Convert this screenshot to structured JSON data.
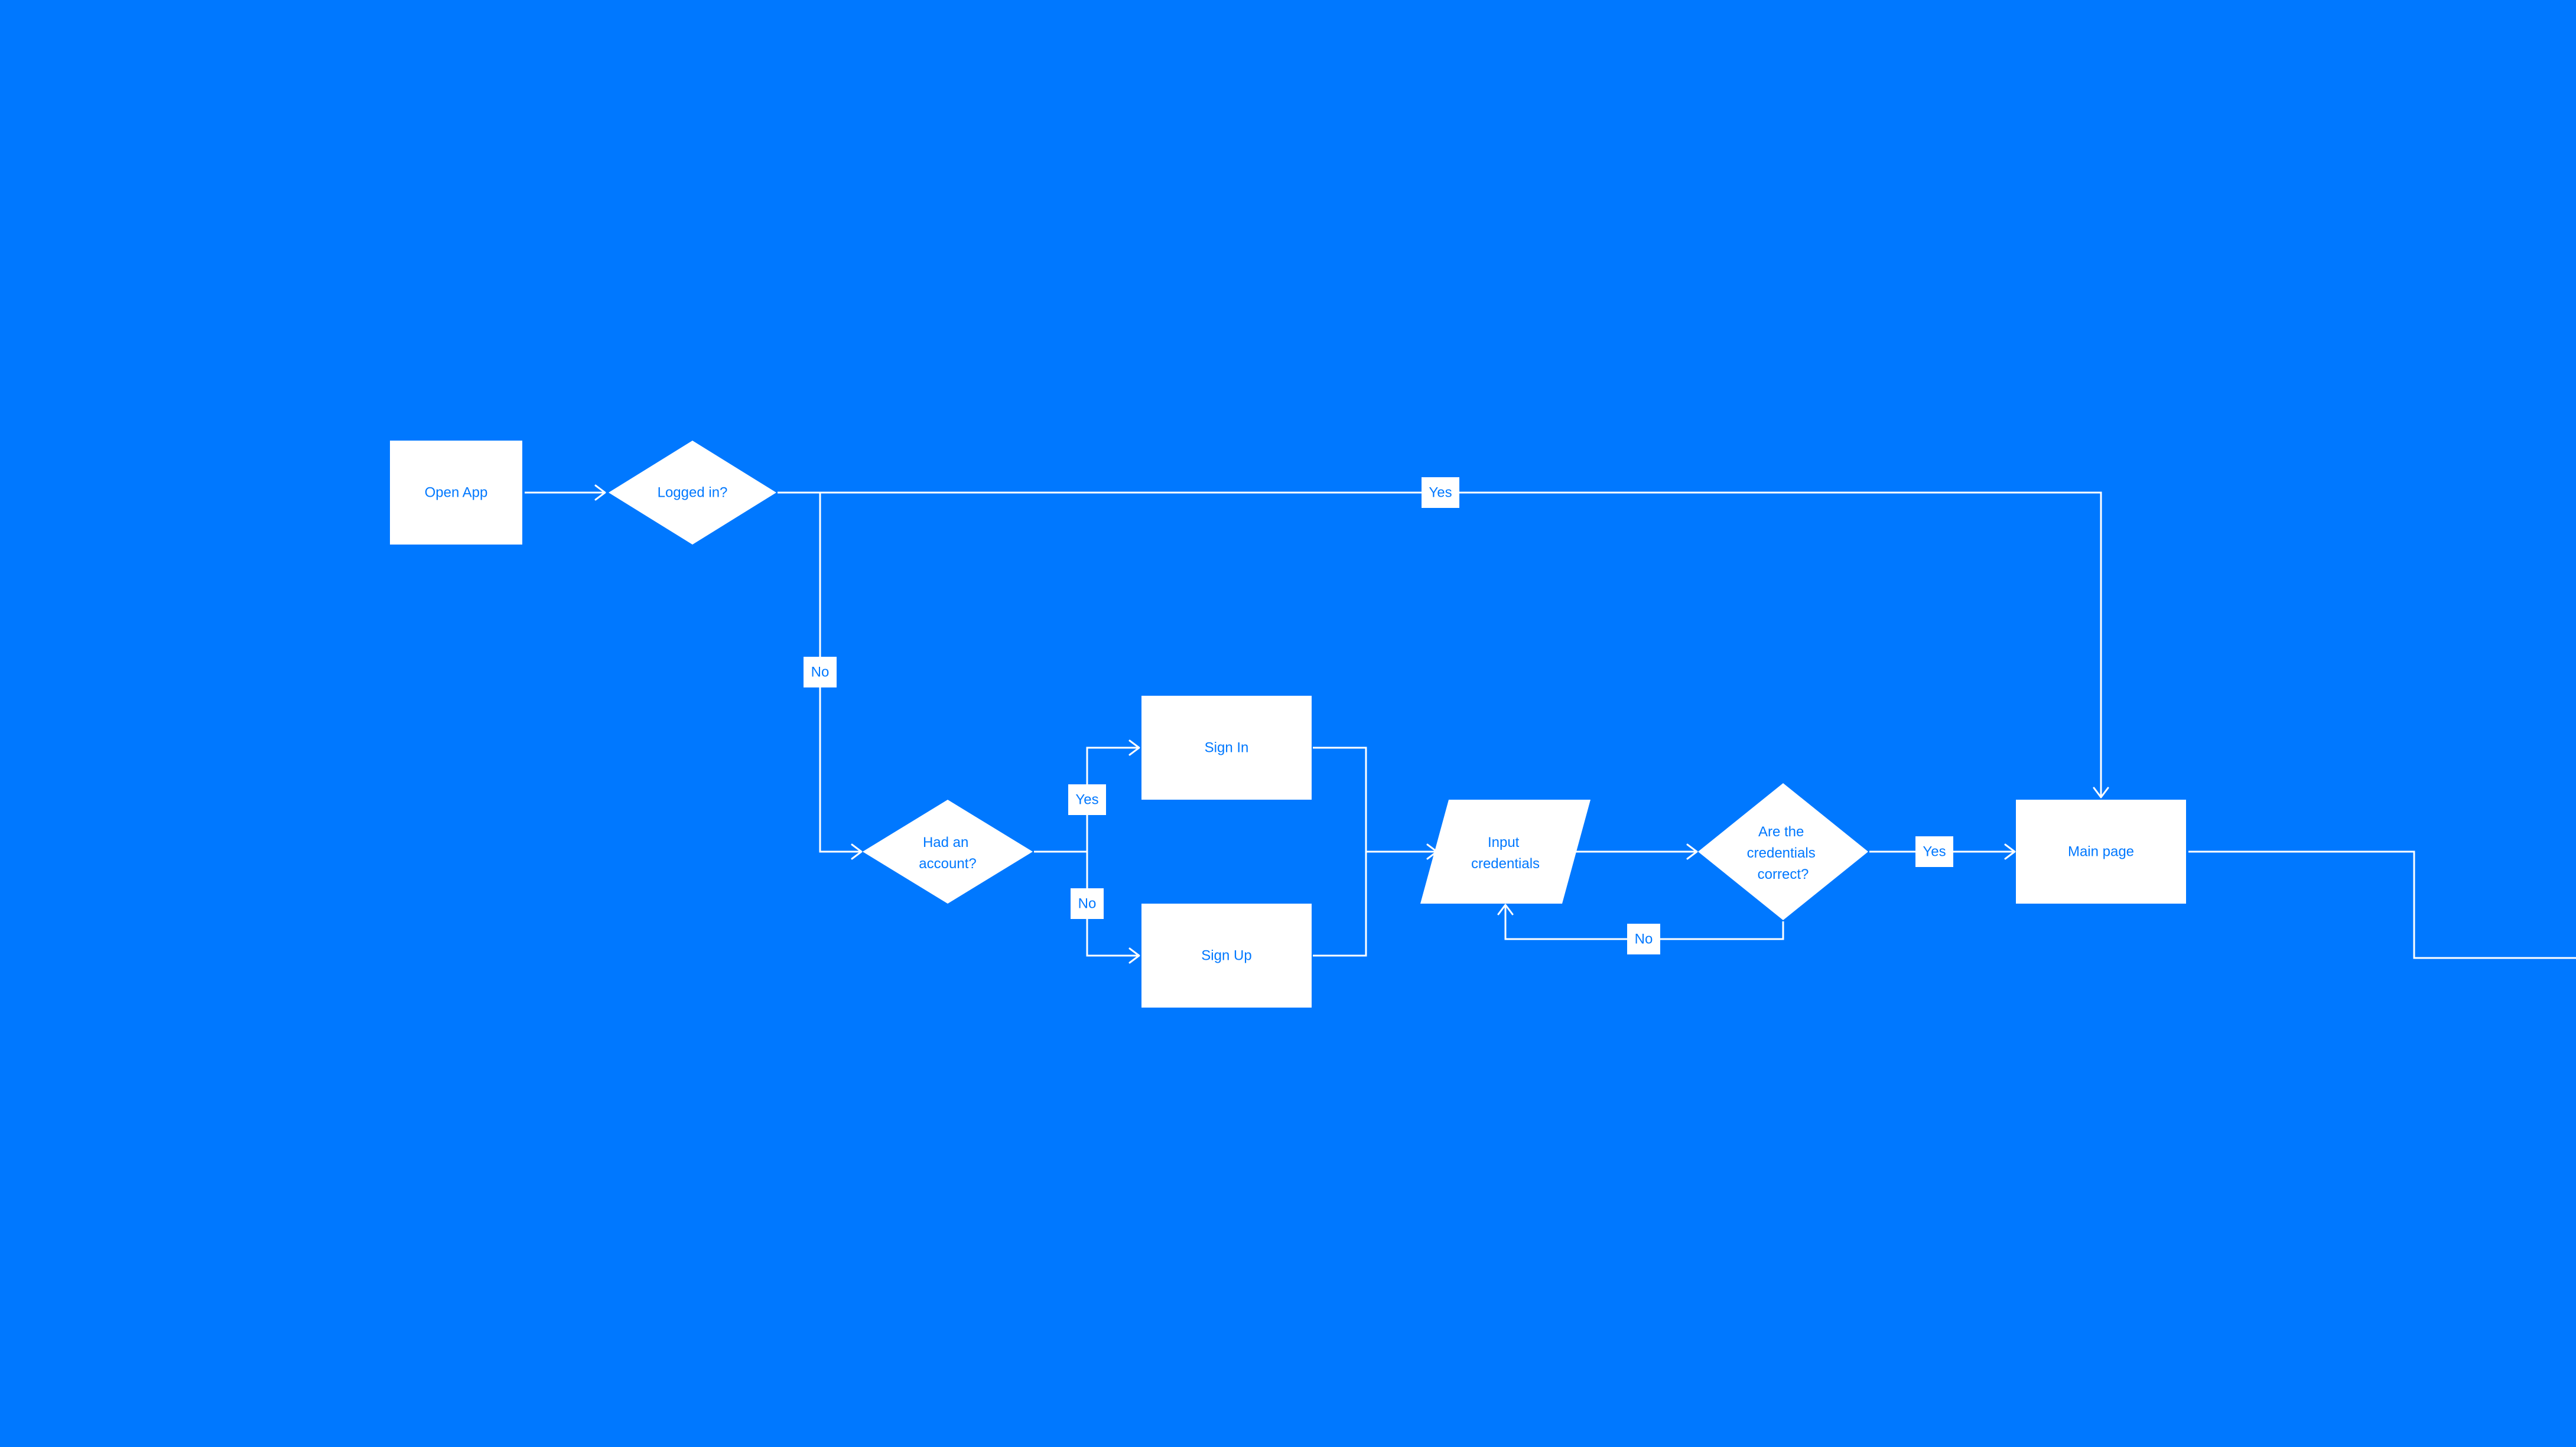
{
  "colors": {
    "background": "#0078FF",
    "shape_fill": "#FFFFFF",
    "text": "#0078FF",
    "line": "#FFFFFF"
  },
  "nodes": {
    "open_app": "Open App",
    "logged_in": "Logged in?",
    "had_account": [
      "Had an",
      "account?"
    ],
    "sign_in": "Sign In",
    "sign_up": "Sign Up",
    "input_credentials": [
      "Input",
      "credentials"
    ],
    "credentials_correct": [
      "Are the",
      "credentials",
      "correct?"
    ],
    "main_page": "Main page"
  },
  "edge_labels": {
    "logged_in_yes": "Yes",
    "logged_in_no": "No",
    "had_account_yes": "Yes",
    "had_account_no": "No",
    "credentials_yes": "Yes",
    "credentials_no": "No"
  }
}
